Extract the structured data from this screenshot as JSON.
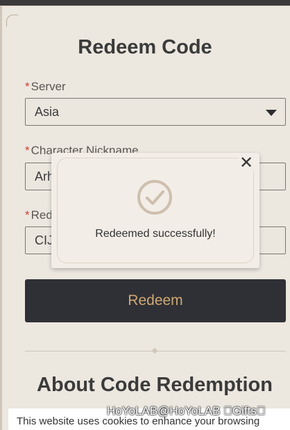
{
  "page": {
    "title": "Redeem Code",
    "about_title": "About Code Redemption"
  },
  "form": {
    "server": {
      "label": "Server",
      "value": "Asia"
    },
    "nickname": {
      "label": "Character Nickname",
      "value": "Arh"
    },
    "code": {
      "label": "Red",
      "value": "CIJ"
    },
    "required_marker": "*",
    "submit_label": "Redeem"
  },
  "modal": {
    "message": "Redeemed successfully!",
    "close_glyph": "✕",
    "icon": "check-circle-icon"
  },
  "overlay": {
    "text": "HoYoLAB@HoYoLAB 󰀀Gifts󰀀"
  },
  "cookie": {
    "text": "This website uses cookies to enhance your browsing"
  },
  "colors": {
    "accent": "#cfa874",
    "button_bg": "#2f3036",
    "required": "#d23c2f",
    "check": "#cdbfae"
  }
}
